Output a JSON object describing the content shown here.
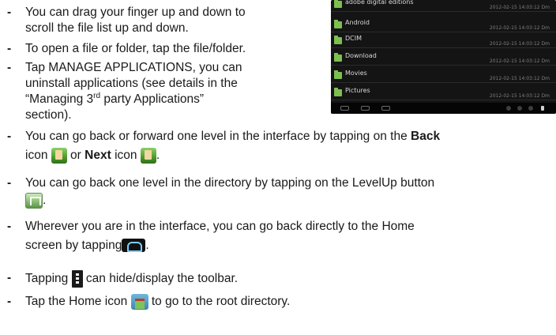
{
  "bullets": [
    {
      "lines": [
        "You can drag your finger up and down to",
        "scroll the file list up and down."
      ]
    },
    {
      "lines": [
        "To open a file or folder, tap the file/folder."
      ]
    },
    {
      "line1": "Tap MANAGE APPLICATIONS, you can",
      "line2": "uninstall applications (see details in the",
      "line3_pre": "“Managing 3",
      "line3_sup": "rd",
      "line3_post": " party Applications”",
      "line4": "section)."
    },
    {
      "pre": "You can go back or forward one level in the interface by tapping on the ",
      "back_bold": "Back",
      "mid1": "icon ",
      "or": " or ",
      "next_bold": "Next",
      "mid2": " icon ",
      "end": "."
    },
    {
      "pre": "You can go back one level in the directory by tapping on the LevelUp button",
      "end": "."
    },
    {
      "pre": "Wherever you are in the interface, you can go back directly to the Home",
      "mid": "screen by tapping",
      "end": "."
    },
    {
      "pre": "Tapping ",
      "post": " can hide/display the toolbar."
    },
    {
      "pre": "Tap the Home icon ",
      "post": " to go to the root directory."
    }
  ],
  "screenshot": {
    "rows": [
      {
        "name": "adobe digital editions",
        "date": "2012-02-15 14:03:12 Dm"
      },
      {
        "name": "Android",
        "date": "2012-02-15 14:03:12 Dm"
      },
      {
        "name": "DCIM",
        "date": "2012-02-15 14:03:12 Dm"
      },
      {
        "name": "Download",
        "date": "2012-02-15 14:03:12 Dm"
      },
      {
        "name": "Movies",
        "date": "2012-02-15 14:03:12 Dm"
      },
      {
        "name": "Pictures",
        "date": "2012-02-15 14:03:12 Dm"
      }
    ]
  },
  "icons": {
    "back": "back-icon",
    "next": "next-icon",
    "levelup": "levelup-icon",
    "home_nav": "home-nav-icon",
    "menu": "menu-icon",
    "home_root": "home-root-icon"
  }
}
